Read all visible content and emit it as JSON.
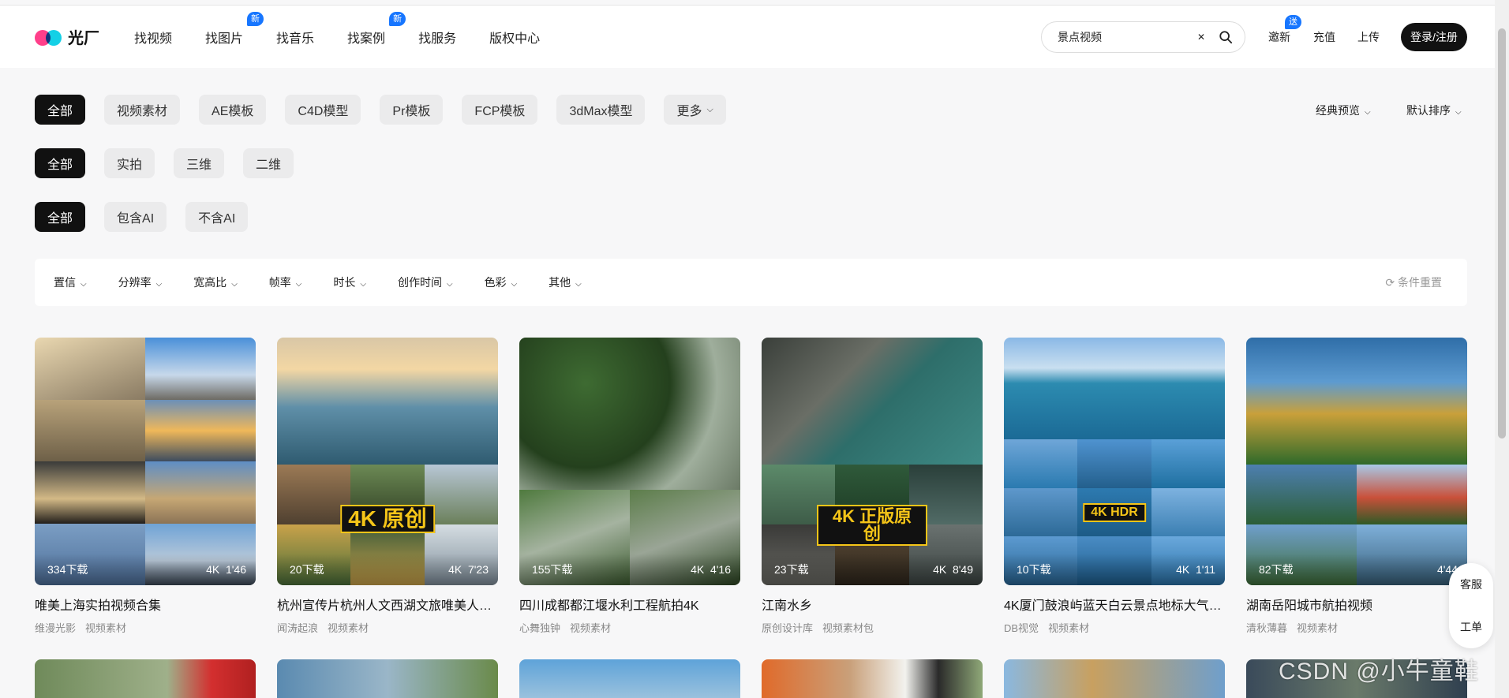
{
  "header": {
    "logo_text": "光厂",
    "nav": [
      {
        "label": "找视频",
        "badge": ""
      },
      {
        "label": "找图片",
        "badge": "新"
      },
      {
        "label": "找音乐",
        "badge": ""
      },
      {
        "label": "找案例",
        "badge": "新"
      },
      {
        "label": "找服务",
        "badge": ""
      },
      {
        "label": "版权中心",
        "badge": ""
      }
    ],
    "search_value": "景点视频",
    "invite": "邀新",
    "invite_badge": "送",
    "recharge": "充值",
    "upload": "上传",
    "login": "登录/注册"
  },
  "filters": {
    "row1": [
      "全部",
      "视频素材",
      "AE模板",
      "C4D模型",
      "Pr模板",
      "FCP模板",
      "3dMax模型",
      "更多"
    ],
    "row2": [
      "全部",
      "实拍",
      "三维",
      "二维"
    ],
    "row3": [
      "全部",
      "包含AI",
      "不含AI"
    ],
    "preview": "经典预览",
    "sort": "默认排序",
    "bar": [
      "置信",
      "分辨率",
      "宽高比",
      "帧率",
      "时长",
      "创作时间",
      "色彩",
      "其他"
    ],
    "reset": "条件重置"
  },
  "cards": [
    {
      "title": "唯美上海实拍视频合集",
      "author": "维漫光影",
      "category": "视频素材",
      "downloads": "334下载",
      "res": "4K",
      "duration": "1'46",
      "stamp": ""
    },
    {
      "title": "杭州宣传片杭州人文西湖文旅唯美人…",
      "author": "闻涛起浪",
      "category": "视频素材",
      "downloads": "20下载",
      "res": "4K",
      "duration": "7'23",
      "stamp": "4K 原创"
    },
    {
      "title": "四川成都都江堰水利工程航拍4K",
      "author": "心舞独钟",
      "category": "视频素材",
      "downloads": "155下载",
      "res": "4K",
      "duration": "4'16",
      "stamp": ""
    },
    {
      "title": "江南水乡",
      "author": "原创设计库",
      "category": "视频素材包",
      "downloads": "23下载",
      "res": "4K",
      "duration": "8'49",
      "stamp": "4K 正版原创"
    },
    {
      "title": "4K厦门鼓浪屿蓝天白云景点地标大气…",
      "author": "DB视觉",
      "category": "视频素材",
      "downloads": "10下载",
      "res": "4K",
      "duration": "1'11",
      "stamp": "4K HDR"
    },
    {
      "title": "湖南岳阳城市航拍视频",
      "author": "清秋薄暮",
      "category": "视频素材",
      "downloads": "82下载",
      "res": "",
      "duration": "4'44",
      "stamp": ""
    }
  ],
  "float": {
    "service": "客服",
    "ticket": "工单"
  },
  "watermark": "CSDN @小牛童鞋",
  "colors": {
    "accent": "#1776ff",
    "active_pill": "#111111"
  }
}
